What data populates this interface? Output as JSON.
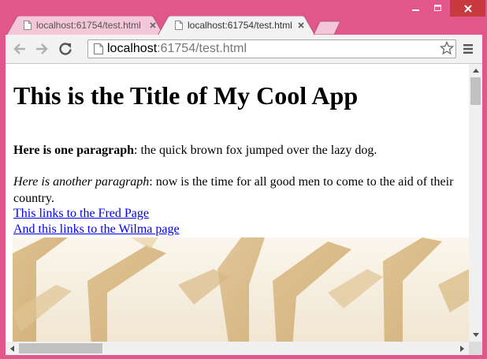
{
  "window": {
    "controls": [
      "minimize-icon",
      "maximize-icon",
      "close-icon"
    ],
    "colors": {
      "frame": "#e1578a",
      "close": "#c7383f"
    }
  },
  "tabs": [
    {
      "title": "localhost:61754/test.html",
      "active": false
    },
    {
      "title": "localhost:61754/test.html",
      "active": true
    }
  ],
  "toolbar": {
    "url_host": "localhost",
    "url_path": ":61754/test.html",
    "icons": [
      "back-icon",
      "forward-icon",
      "reload-icon",
      "page-icon",
      "star-icon",
      "menu-icon"
    ]
  },
  "page": {
    "title": "This is the Title of My Cool App",
    "paragraph1": {
      "bold": "Here is one paragraph",
      "rest": ": the quick brown fox jumped over the lazy dog."
    },
    "paragraph2": {
      "italic": "Here is another paragraph",
      "rest": ": now is the time for all good men to come to the aid of their country."
    },
    "links": [
      "This links to the Fred Page",
      "And this links to the Wilma page"
    ],
    "link_color": "#0000ee"
  }
}
